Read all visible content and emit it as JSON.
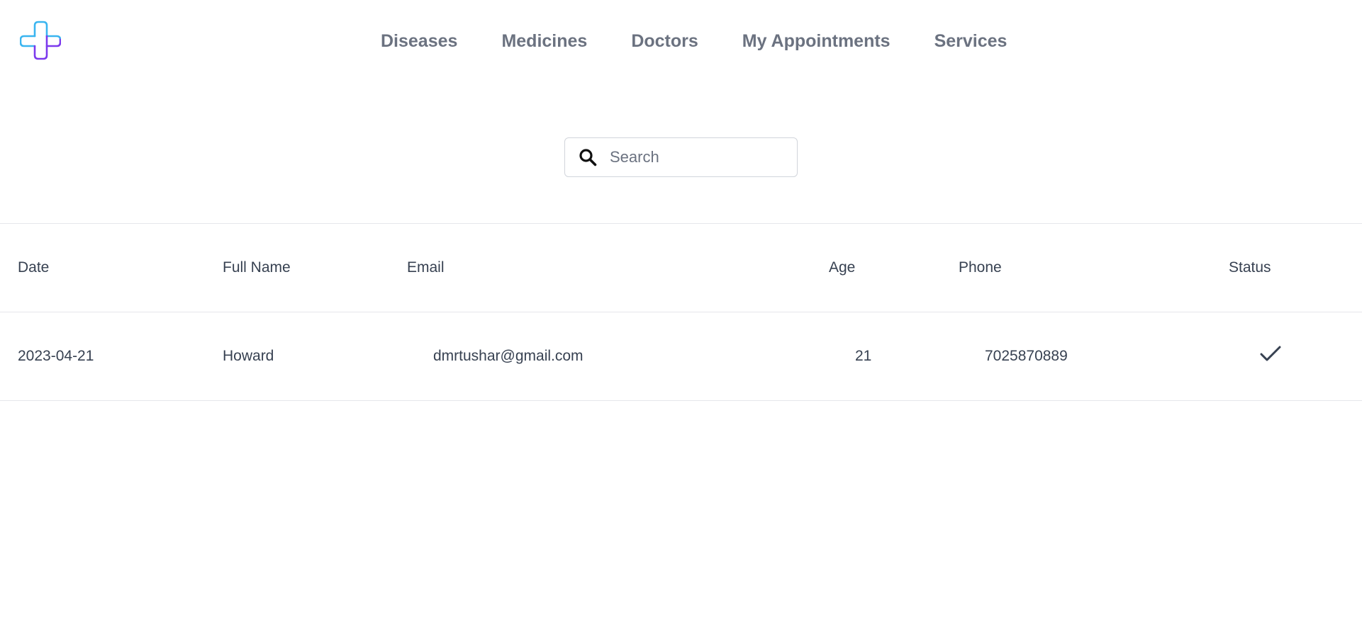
{
  "header": {
    "logo_icon": "medical-cross-logo-icon",
    "logo_colors": [
      "#3ab5f0",
      "#7c3aed"
    ],
    "nav": [
      {
        "label": "Diseases"
      },
      {
        "label": "Medicines"
      },
      {
        "label": "Doctors"
      },
      {
        "label": "My Appointments"
      },
      {
        "label": "Services"
      }
    ]
  },
  "search": {
    "icon": "search-icon",
    "placeholder": "Search",
    "value": ""
  },
  "table": {
    "columns": [
      "Date",
      "Full Name",
      "Email",
      "Age",
      "Phone",
      "Status"
    ],
    "rows": [
      {
        "date": "2023-04-21",
        "full_name": "Howard",
        "email": "dmrtushar@gmail.com",
        "age": "21",
        "phone": "7025870889",
        "status_icon": "checkmark-icon"
      }
    ]
  }
}
